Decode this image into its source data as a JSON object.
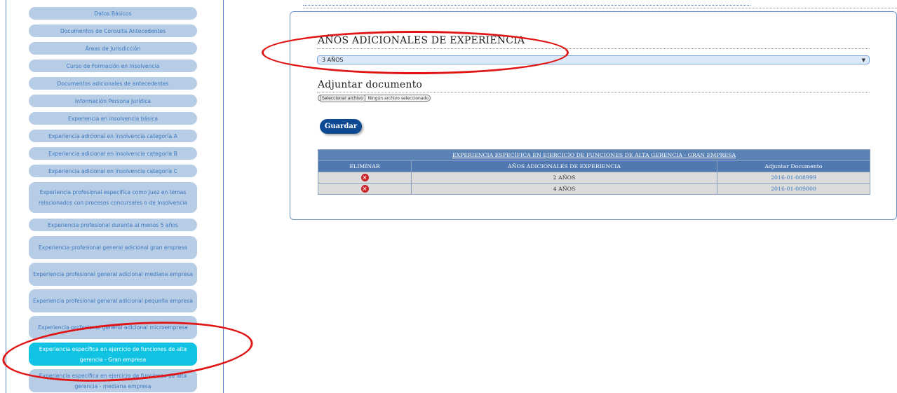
{
  "sidebar": {
    "items": [
      {
        "label": "Datos Básicos"
      },
      {
        "label": "Documentos de Consulta Antecedentes"
      },
      {
        "label": "Áreas de Jurisdicción"
      },
      {
        "label": "Curso de Formación en Insolvencia"
      },
      {
        "label": "Documentos adicionales de antecedentes"
      },
      {
        "label": "Información Persona Jurídica"
      },
      {
        "label": "Experiencia en insolvencia básica"
      },
      {
        "label": "Experiencia adicional en insolvencia categoría A"
      },
      {
        "label": "Experiencia adicional en insolvencia categoría B"
      },
      {
        "label": "Experiencia adicional en insolvencia categoría C"
      },
      {
        "label": "Experiencia profesional específica como Juez en temas relacionados con procesos concursales o de Insolvencia"
      },
      {
        "label": "Experiencia profesional durante al menos 5 años"
      },
      {
        "label": "Experiencia profesional general adicional gran empresa"
      },
      {
        "label": "Experiencia profesional general adicional mediana empresa"
      },
      {
        "label": "Experiencia profesional general adicional pequeña empresa"
      },
      {
        "label": "Experiencia profesional general adicional microempresa"
      },
      {
        "label": "Experiencia específica en ejercicio de funciones de alta gerencia - Gran empresa"
      },
      {
        "label": "Experiencia específica en ejercicio de funciones de alta gerencia - mediana empresa"
      }
    ]
  },
  "form": {
    "years_label": "AÑOS ADICIONALES DE EXPERIENCIA",
    "years_value": "3 AÑOS",
    "attach_label": "Adjuntar documento",
    "file_button": "Seleccionar archivo",
    "file_status": "Ningún archivo seleccionado",
    "save_label": "Guardar"
  },
  "table": {
    "caption": "EXPERIENCIA ESPECÍFICA EN EJERCICIO DE FUNCIONES DE ALTA GERENCIA - GRAN EMPRESA",
    "headers": [
      "ELIMINAR",
      "AÑOS ADICIONALES DE EXPERIENCIA",
      "Adjuntar Documento"
    ],
    "rows": [
      {
        "delete": "×",
        "years": "2 AÑOS",
        "document": "2016-01-008999"
      },
      {
        "delete": "×",
        "years": "4 AÑOS",
        "document": "2016-01-009000"
      }
    ]
  },
  "colors": {
    "nav_bg": "#b7cde6",
    "nav_active_bg": "#10c3e3",
    "header_blue": "#4f79b0",
    "save_button": "#0e4a93",
    "annotation": "#e01515"
  }
}
